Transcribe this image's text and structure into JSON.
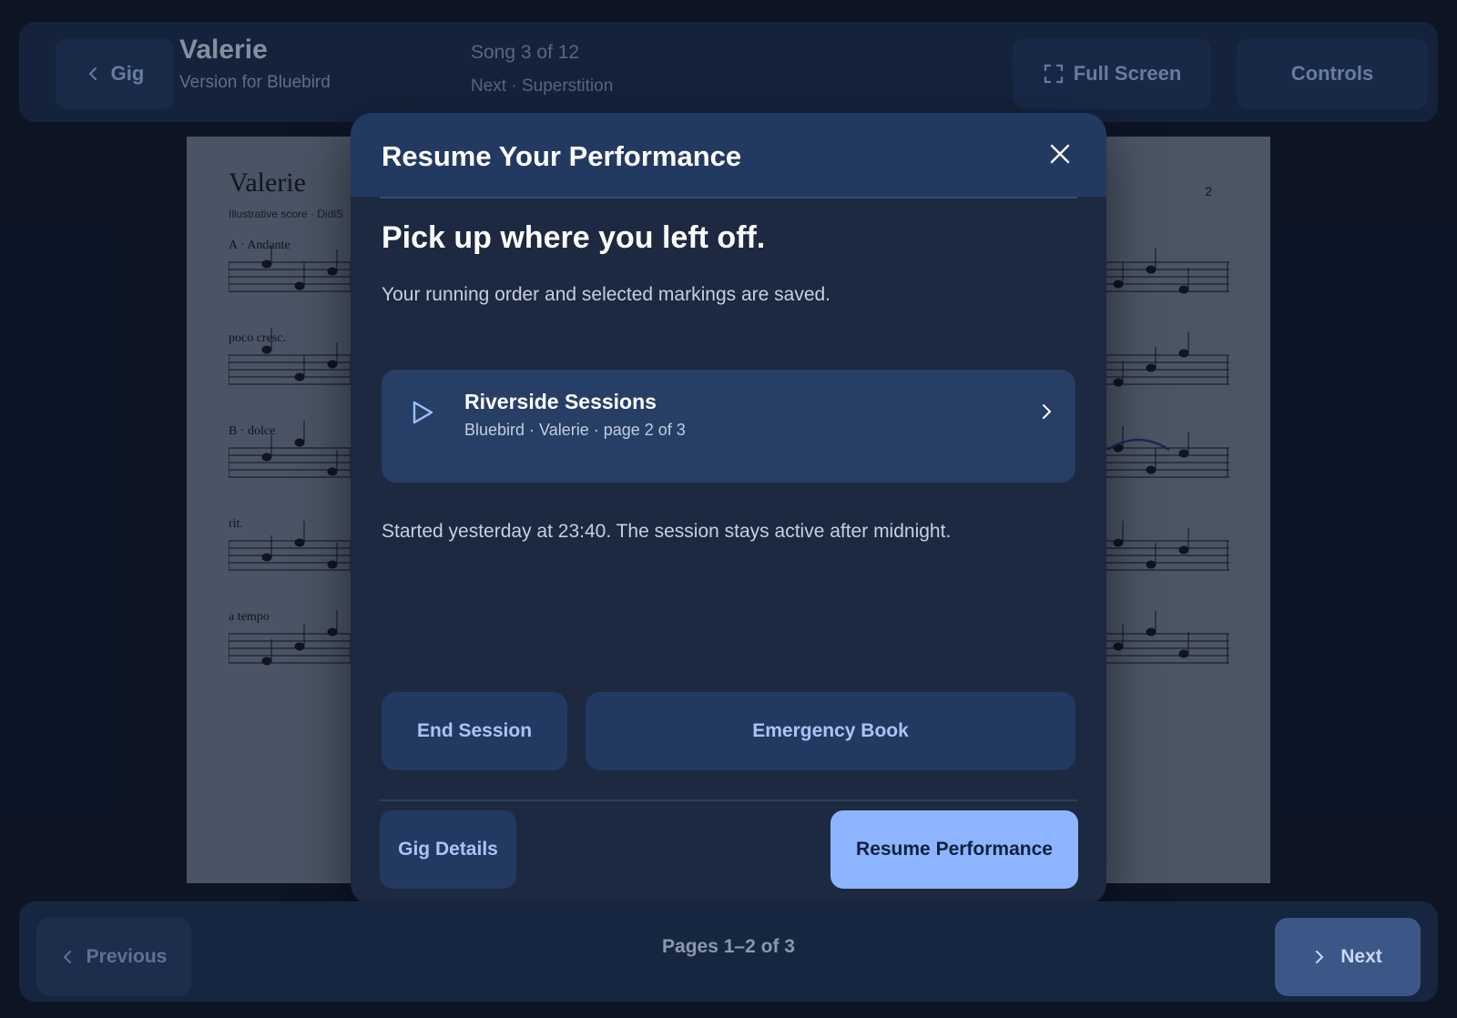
{
  "header": {
    "back_label": "Gig",
    "song_title": "Valerie",
    "song_version": "Version for Bluebird",
    "song_position": "Song 3 of 12",
    "next_song": "Next · Superstition",
    "fullscreen_label": "Full Screen",
    "controls_label": "Controls"
  },
  "score": {
    "title": "Valerie",
    "subtitle": "Illustrative score · DidiS",
    "page_number": "2",
    "staff_labels": [
      "A · Andante",
      "poco cresc.",
      "B · dolce",
      "rit.",
      "a tempo"
    ]
  },
  "modal": {
    "title": "Resume Your Performance",
    "headline": "Pick up where you left off.",
    "description": "Your running order and selected markings are saved.",
    "session": {
      "name": "Riverside Sessions",
      "details": "Bluebird · Valerie · page 2 of 3"
    },
    "started_note": "Started yesterday at 23:40. The session stays active after midnight.",
    "end_session_label": "End Session",
    "emergency_book_label": "Emergency Book",
    "gig_details_label": "Gig Details",
    "resume_label": "Resume Performance"
  },
  "footer": {
    "previous_label": "Previous",
    "pages_label": "Pages 1–2 of 3",
    "next_label": "Next"
  },
  "colors": {
    "accent": "#8db4ff",
    "background": "#101a2c",
    "modal": "#1d2940"
  }
}
